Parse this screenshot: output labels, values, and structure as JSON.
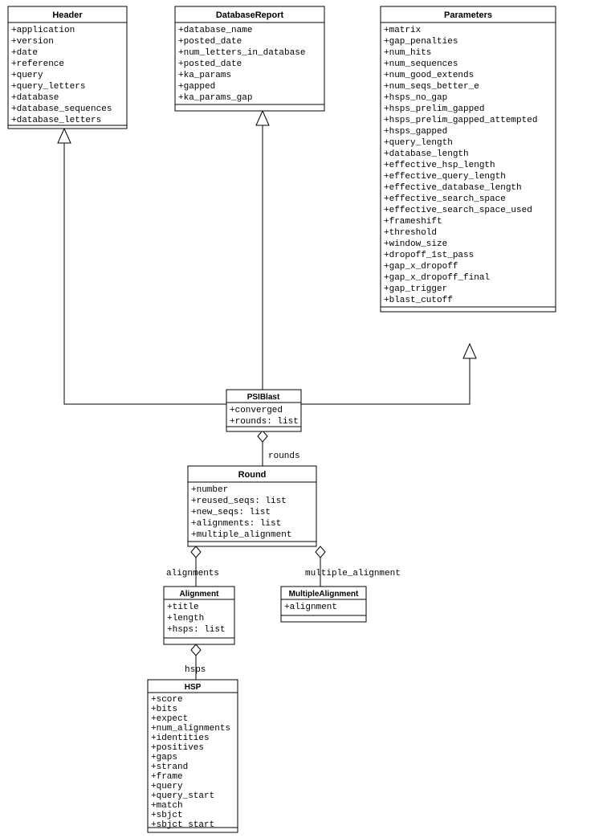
{
  "classes": {
    "Header": {
      "title": "Header",
      "attrs": [
        "+application",
        "+version",
        "+date",
        "+reference",
        "+query",
        "+query_letters",
        "+database",
        "+database_sequences",
        "+database_letters"
      ]
    },
    "DatabaseReport": {
      "title": "DatabaseReport",
      "attrs": [
        "+database_name",
        "+posted_date",
        "+num_letters_in_database",
        "+posted_date",
        "+ka_params",
        "+gapped",
        "+ka_params_gap"
      ]
    },
    "Parameters": {
      "title": "Parameters",
      "attrs": [
        "+matrix",
        "+gap_penalties",
        "+num_hits",
        "+num_sequences",
        "+num_good_extends",
        "+num_seqs_better_e",
        "+hsps_no_gap",
        "+hsps_prelim_gapped",
        "+hsps_prelim_gapped_attempted",
        "+hsps_gapped",
        "+query_length",
        "+database_length",
        "+effective_hsp_length",
        "+effective_query_length",
        "+effective_database_length",
        "+effective_search_space",
        "+effective_search_space_used",
        "+frameshift",
        "+threshold",
        "+window_size",
        "+dropoff_1st_pass",
        "+gap_x_dropoff",
        "+gap_x_dropoff_final",
        "+gap_trigger",
        "+blast_cutoff"
      ]
    },
    "PSIBlast": {
      "title": "PSIBlast",
      "attrs": [
        "+converged",
        "+rounds: list"
      ]
    },
    "Round": {
      "title": "Round",
      "attrs": [
        "+number",
        "+reused_seqs: list",
        "+new_seqs: list",
        "+alignments: list",
        "+multiple_alignment"
      ]
    },
    "Alignment": {
      "title": "Alignment",
      "attrs": [
        "+title",
        "+length",
        "+hsps: list"
      ]
    },
    "MultipleAlignment": {
      "title": "MultipleAlignment",
      "attrs": [
        "+alignment"
      ]
    },
    "HSP": {
      "title": "HSP",
      "attrs": [
        "+score",
        "+bits",
        "+expect",
        "+num_alignments",
        "+identities",
        "+positives",
        "+gaps",
        "+strand",
        "+frame",
        "+query",
        "+query_start",
        "+match",
        "+sbjct",
        "+sbjct_start"
      ]
    }
  },
  "relations": {
    "alignments": "alignments",
    "hsps": "hsps",
    "rounds": "rounds",
    "multiple_alignment": "multiple_alignment"
  }
}
